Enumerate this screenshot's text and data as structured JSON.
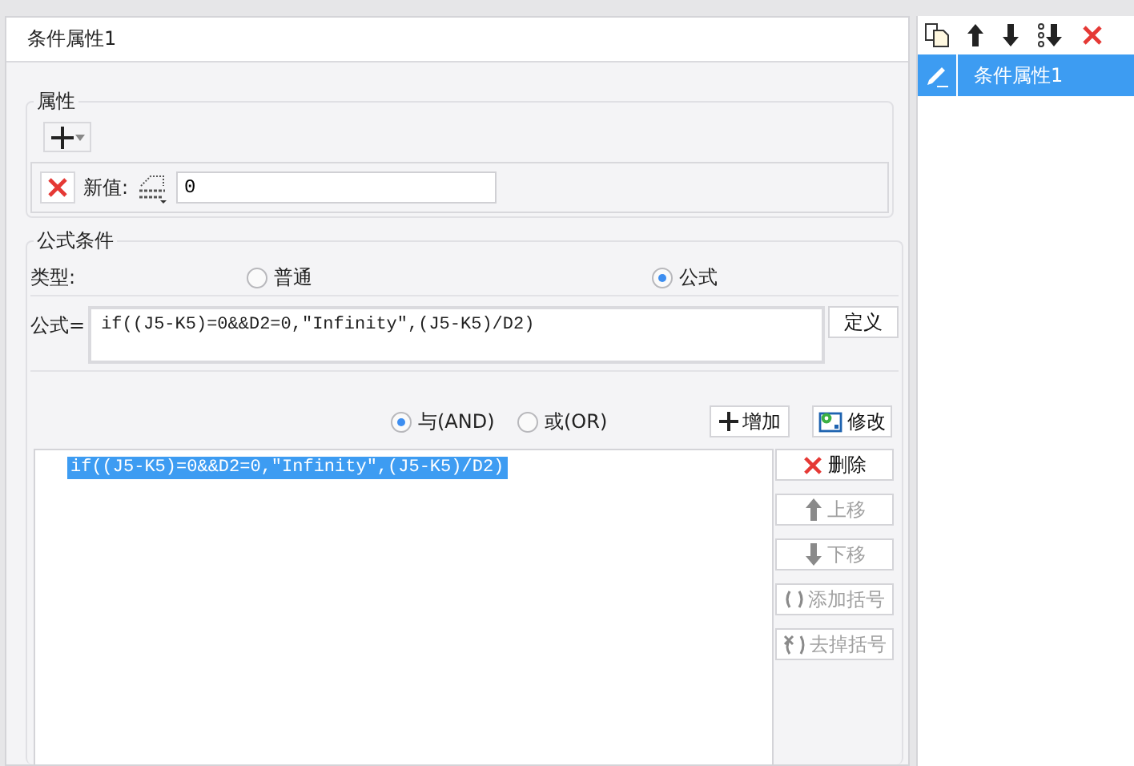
{
  "dialog": {
    "title": "条件属性1"
  },
  "attributes": {
    "legend": "属性",
    "new_value": {
      "label": "新值:",
      "value": "0"
    }
  },
  "formula_condition": {
    "legend": "公式条件",
    "type_label": "类型:",
    "types": [
      {
        "label": "普通",
        "selected": false
      },
      {
        "label": "公式",
        "selected": true
      }
    ],
    "formula_label": "公式=",
    "formula": "if((J5-K5)=0&&D2=0,\"Infinity\",(J5-K5)/D2)",
    "define_button": "定义",
    "logic": [
      {
        "label": "与(AND)",
        "selected": true
      },
      {
        "label": "或(OR)",
        "selected": false
      }
    ],
    "actions": [
      {
        "kind": "add",
        "label": "增加"
      },
      {
        "kind": "edit",
        "label": "修改"
      }
    ],
    "conditions": [
      {
        "text": "if((J5-K5)=0&&D2=0,\"Infinity\",(J5-K5)/D2)",
        "selected": true
      }
    ],
    "side_buttons": [
      {
        "kind": "delete",
        "label": "删除",
        "disabled": false
      },
      {
        "kind": "up",
        "label": "上移",
        "disabled": true
      },
      {
        "kind": "down",
        "label": "下移",
        "disabled": true
      },
      {
        "kind": "add-paren",
        "label": "添加括号",
        "disabled": true
      },
      {
        "kind": "remove-paren",
        "label": "去掉括号",
        "disabled": true
      }
    ]
  },
  "side_panel": {
    "items": [
      {
        "label": "条件属性1",
        "selected": true
      }
    ]
  }
}
